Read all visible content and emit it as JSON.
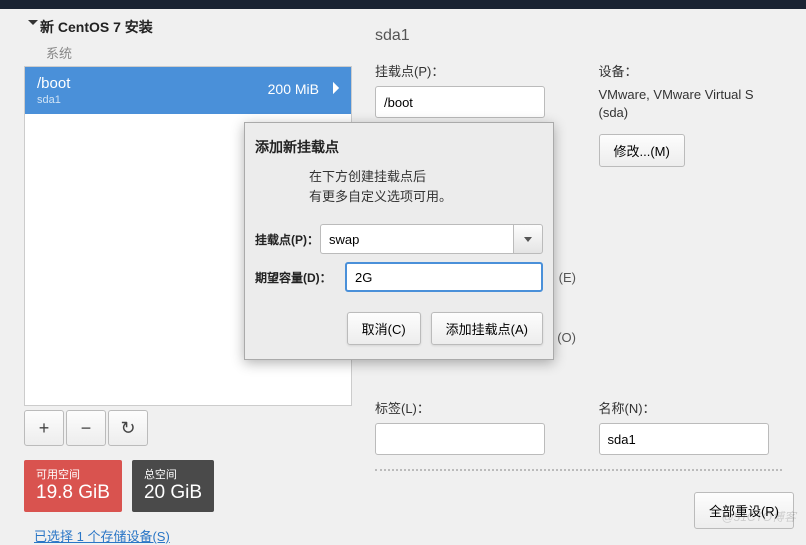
{
  "tree": {
    "header": "新 CentOS 7 安装",
    "sub": "系统",
    "partition": {
      "mount": "/boot",
      "dev": "sda1",
      "size": "200 MiB"
    }
  },
  "actions": {
    "add": "+",
    "remove": "−",
    "reload": "↻"
  },
  "space": {
    "avail_label": "可用空间",
    "avail_val": "19.8 GiB",
    "total_label": "总空间",
    "total_val": "20 GiB"
  },
  "storage_link": "已选择 1 个存储设备(S)",
  "right": {
    "title": "sda1",
    "mountpoint_label": "挂载点(P)：",
    "mountpoint_val": "/boot",
    "device_label": "设备：",
    "device_val": "VMware, VMware Virtual S (sda)",
    "modify": "修改...(M)",
    "enc": "(E)",
    "reformat": "(O)",
    "label_label": "标签(L)：",
    "label_val": "",
    "name_label": "名称(N)：",
    "name_val": "sda1",
    "reset": "全部重设(R)"
  },
  "modal": {
    "title": "添加新挂载点",
    "msg1": "在下方创建挂载点后",
    "msg2": "有更多自定义选项可用。",
    "mount_label": "挂载点(P)：",
    "mount_val": "swap",
    "capacity_label": "期望容量(D)：",
    "capacity_val": "2G",
    "cancel": "取消(C)",
    "add": "添加挂载点(A)"
  },
  "watermark": "@51CTO博客"
}
